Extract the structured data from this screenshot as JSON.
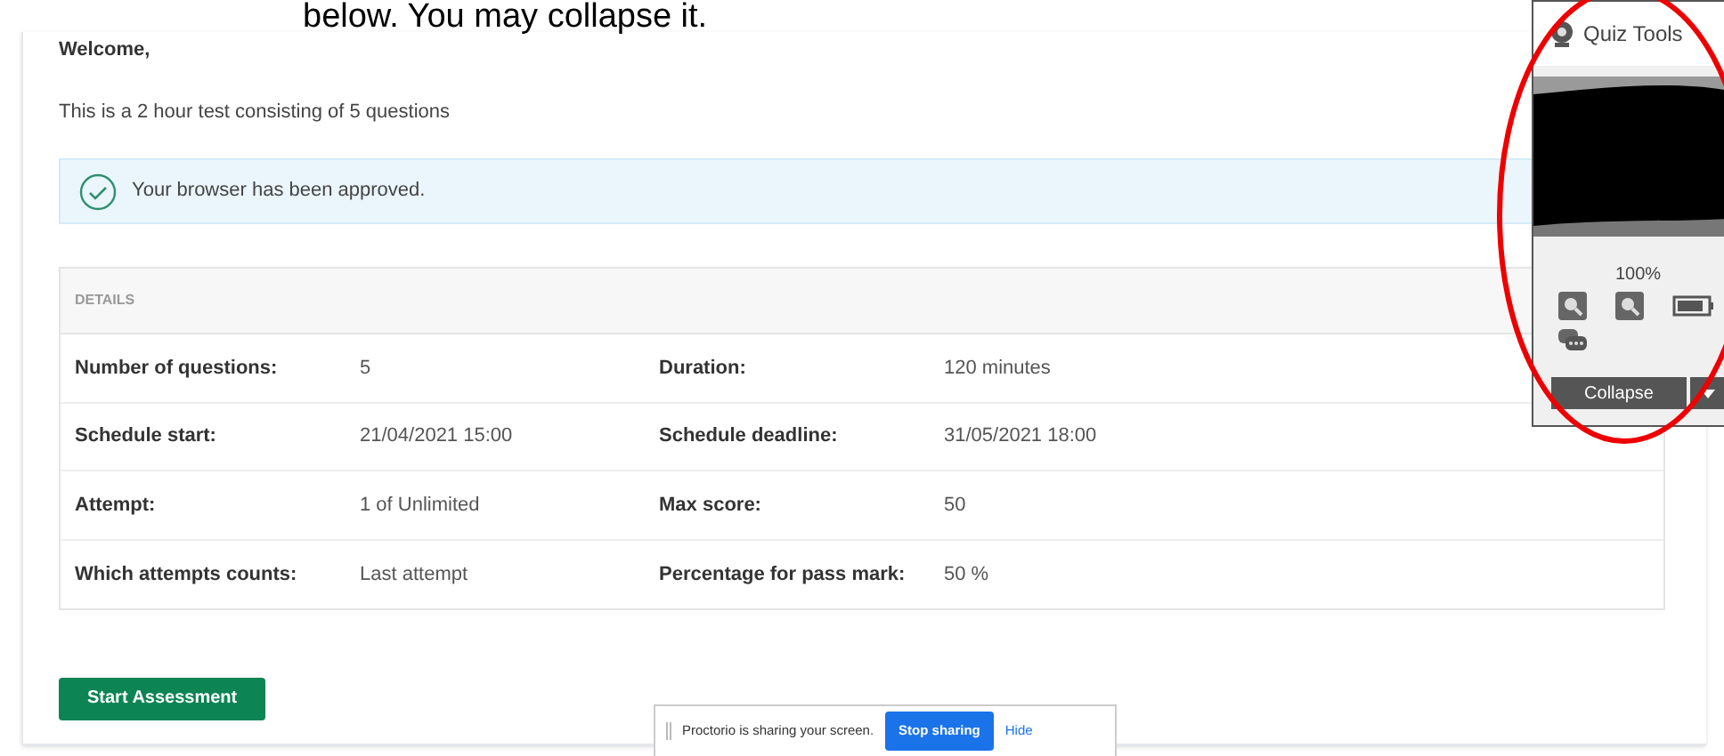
{
  "caption": "below. You may collapse it.",
  "welcome": "Welcome,",
  "description": "This is a 2 hour test consisting of 5 questions",
  "alert": {
    "text": "Your browser has been approved."
  },
  "details": {
    "heading": "DETAILS",
    "rows": [
      {
        "label_1": "Number of questions:",
        "value_1": "5",
        "label_2": "Duration:",
        "value_2": "120 minutes"
      },
      {
        "label_1": "Schedule start:",
        "value_1": "21/04/2021 15:00",
        "label_2": "Schedule deadline:",
        "value_2": "31/05/2021 18:00"
      },
      {
        "label_1": "Attempt:",
        "value_1": "1 of Unlimited",
        "label_2": "Max score:",
        "value_2": "50"
      },
      {
        "label_1": "Which attempts counts:",
        "value_1": "Last attempt",
        "label_2": "Percentage for pass mark:",
        "value_2": "50 %"
      }
    ]
  },
  "start_button": "Start Assessment",
  "quiz_tools": {
    "title": "Quiz Tools",
    "zoom": "100%",
    "collapse": "Collapse"
  },
  "sharing_bar": {
    "text": "Proctorio is sharing your screen.",
    "stop": "Stop sharing",
    "hide": "Hide"
  }
}
